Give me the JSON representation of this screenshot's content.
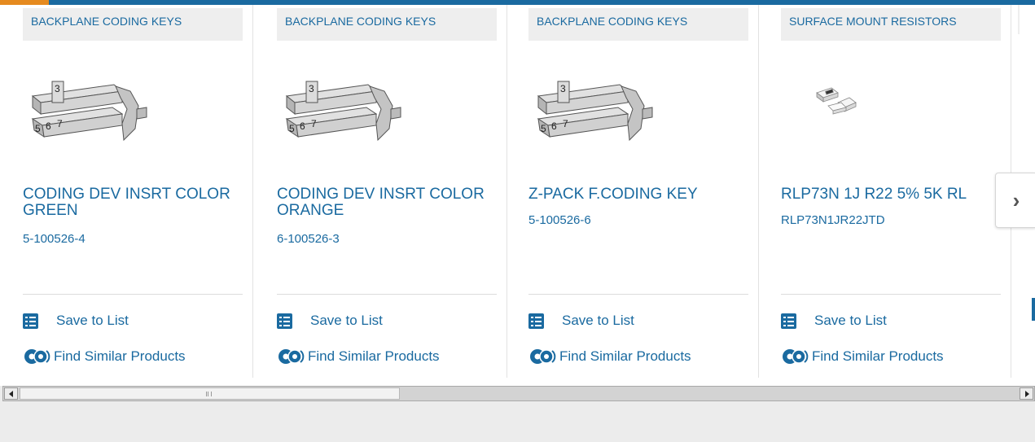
{
  "products": [
    {
      "category": "BACKPLANE CODING KEYS",
      "name": "CODING DEV INSRT COLOR GREEN",
      "part_number": "5-100526-4",
      "image": "coding-key"
    },
    {
      "category": "BACKPLANE CODING KEYS",
      "name": "CODING DEV INSRT COLOR ORANGE",
      "part_number": "6-100526-3",
      "image": "coding-key"
    },
    {
      "category": "BACKPLANE CODING KEYS",
      "name": "Z-PACK F.CODING KEY",
      "part_number": "5-100526-6",
      "image": "coding-key"
    },
    {
      "category": "SURFACE MOUNT RESISTORS",
      "name": "RLP73N 1J R22 5% 5K RL",
      "part_number": "RLP73N1JR22JTD",
      "image": "resistors"
    }
  ],
  "actions": {
    "save_label": "Save to List",
    "similar_label": "Find Similar Products"
  },
  "icons": {
    "save": "list-check-icon",
    "similar": "gears-icon",
    "next": "chevron-right-icon"
  },
  "colors": {
    "brand": "#1a6aa0",
    "accent": "#e58a1f",
    "category_bg": "#eeeeee"
  }
}
